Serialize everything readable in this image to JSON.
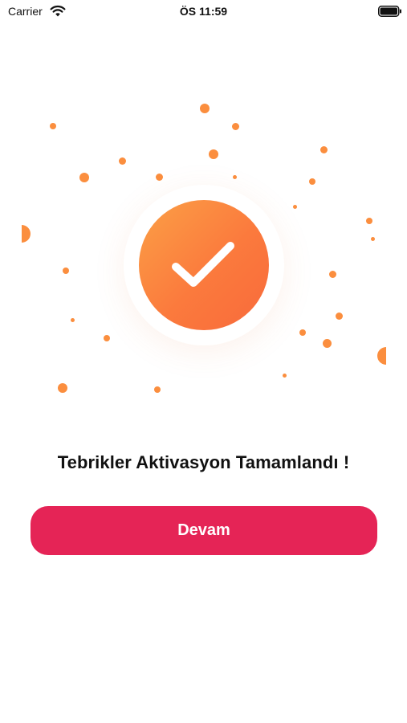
{
  "status_bar": {
    "carrier": "Carrier",
    "time": "ÖS 11:59",
    "wifi_icon": "wifi-icon",
    "battery_icon": "battery-icon"
  },
  "illustration": {
    "icon": "checkmark-icon",
    "accent_color": "#fb8e3e",
    "decoration": "confetti-dots"
  },
  "message": "Tebrikler Aktivasyon Tamamlandı !",
  "button": {
    "label": "Devam",
    "color": "#e52456"
  }
}
